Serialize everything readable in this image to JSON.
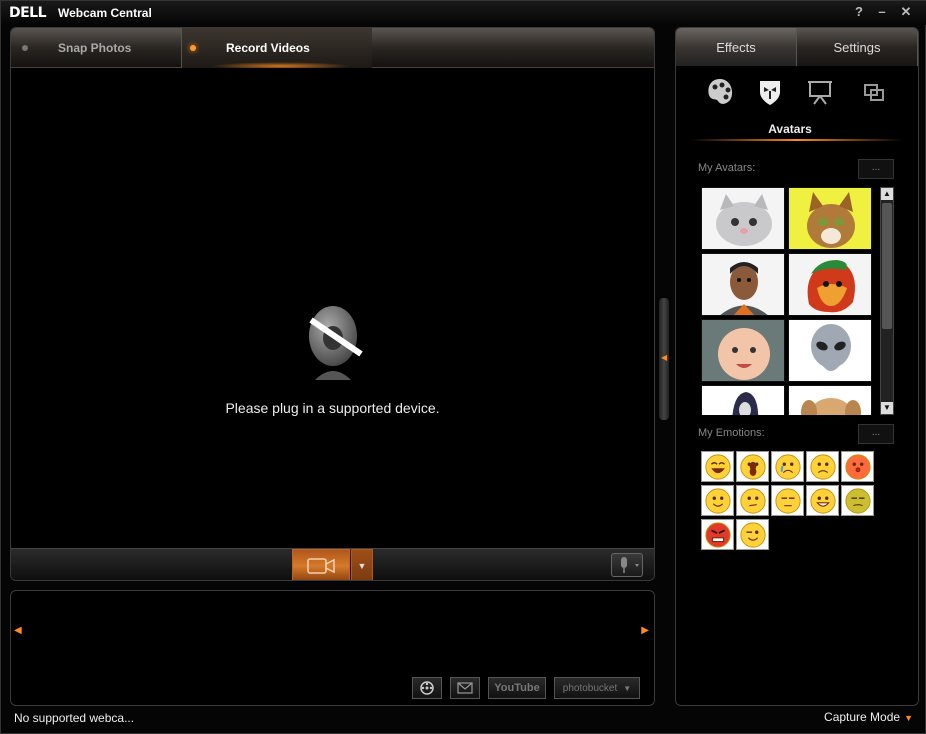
{
  "app": {
    "logo": "DELL",
    "title": "Webcam Central",
    "controls": {
      "help": "?",
      "minimize": "–",
      "close": "✕"
    }
  },
  "main": {
    "tabs": [
      {
        "label": "Snap Photos",
        "active": false
      },
      {
        "label": "Record Videos",
        "active": true
      }
    ],
    "message": "Please plug in a supported device.",
    "record_icon": "video-camera-icon",
    "mic_icon": "microphone-icon"
  },
  "gallery": {
    "share": {
      "youtube": "YouTube",
      "photobucket": "photobucket"
    }
  },
  "status": {
    "text": "No supported webca...",
    "capture_mode": "Capture Mode"
  },
  "right": {
    "tabs": [
      {
        "label": "Effects",
        "active": true
      },
      {
        "label": "Settings",
        "active": false
      }
    ],
    "effect_icons": [
      "palette-icon",
      "avatar-mask-icon",
      "presentation-icon",
      "overlay-icon"
    ],
    "section_title": "Avatars",
    "my_avatars_label": "My Avatars:",
    "my_emotions_label": "My Emotions:",
    "more_button": "...",
    "avatars": [
      "kitten-white",
      "cat-tabby",
      "man-cartoon",
      "fire-face",
      "baby",
      "alien",
      "hooded-figure",
      "puppy"
    ],
    "emotions": [
      "laughing",
      "surprised",
      "crying",
      "worried",
      "kiss",
      "smile",
      "thinking",
      "sleepy",
      "grin",
      "sick",
      "angry",
      "wink"
    ],
    "colors": {
      "accent": "#ff8a20",
      "record": "#d67a2a"
    }
  }
}
